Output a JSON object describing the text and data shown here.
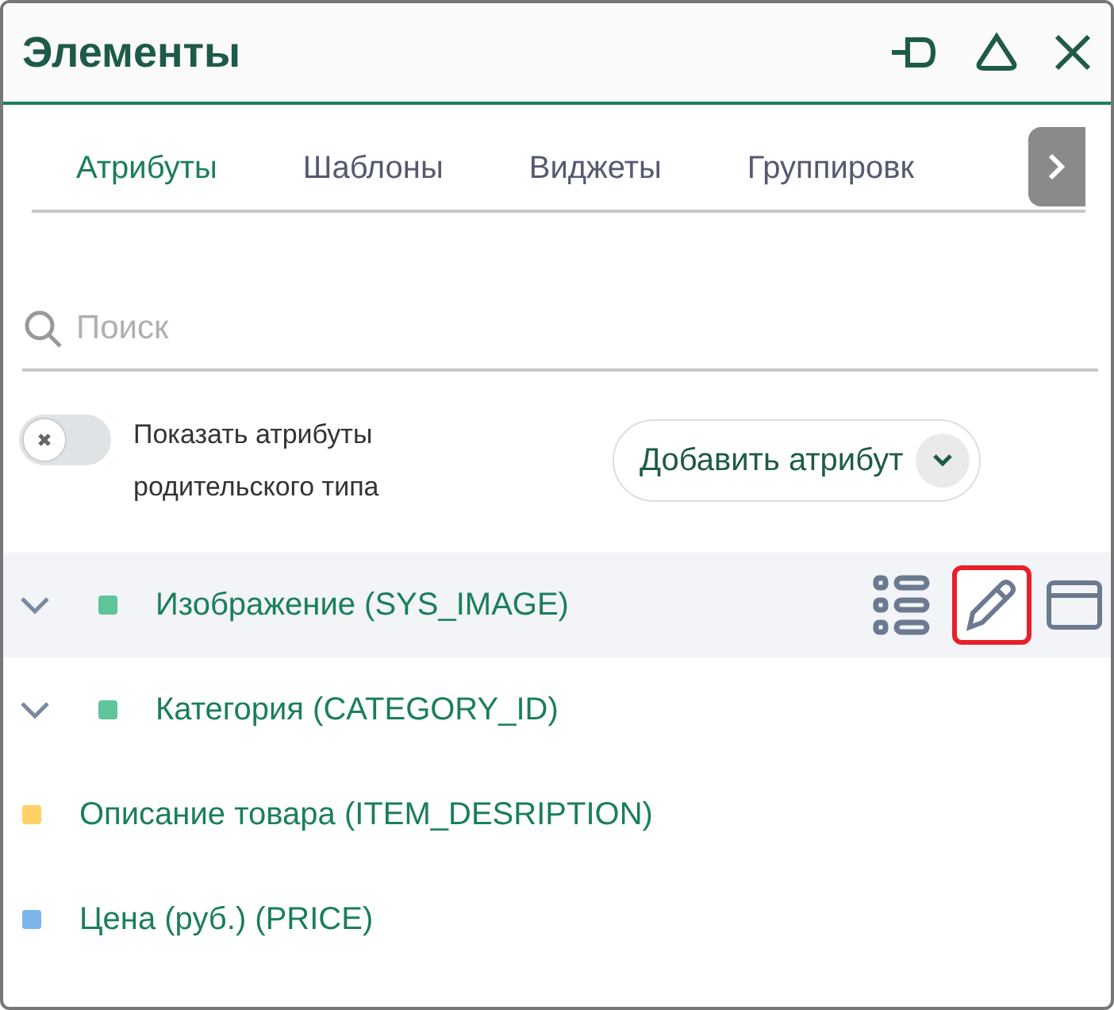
{
  "window": {
    "title": "Элементы"
  },
  "tabs": [
    {
      "label": "Атрибуты",
      "selected": true
    },
    {
      "label": "Шаблоны",
      "selected": false
    },
    {
      "label": "Виджеты",
      "selected": false
    },
    {
      "label": "Группировк",
      "selected": false
    }
  ],
  "search": {
    "placeholder": "Поиск"
  },
  "parent_toggle": {
    "label": "Показать атрибуты родительского типа",
    "checked": false
  },
  "add_button": {
    "label": "Добавить атрибут"
  },
  "attributes": [
    {
      "kind": "group",
      "label": "Изображение (SYS_IMAGE)",
      "color": "#5ec59a",
      "selected": true,
      "edit_highlighted": true
    },
    {
      "kind": "group",
      "label": "Категория (CATEGORY_ID)",
      "color": "#5ec59a",
      "selected": false
    },
    {
      "kind": "item",
      "label": "Описание товара (ITEM_DESRIPTION)",
      "color": "#ffd166",
      "selected": false
    },
    {
      "kind": "item",
      "label": "Цена (руб.) (PRICE)",
      "color": "#7cb5ec",
      "selected": false
    }
  ]
}
